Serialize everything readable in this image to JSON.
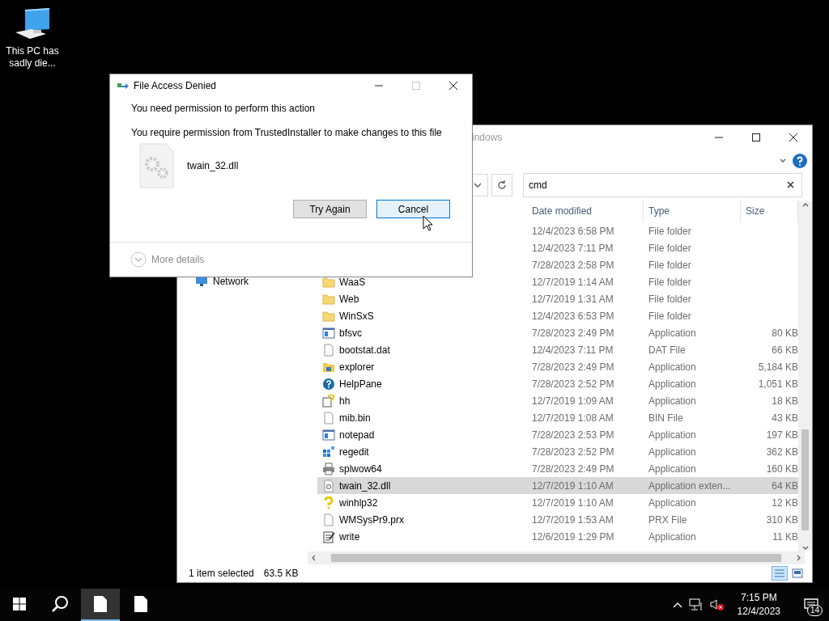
{
  "desktop": {
    "icons": [
      {
        "label": "This PC has sadly die..."
      }
    ]
  },
  "explorer": {
    "title": "indows",
    "search": {
      "value": "cmd"
    },
    "nav_items": [
      {
        "label": "Network"
      }
    ],
    "columns": [
      "Date modified",
      "Type",
      "Size"
    ],
    "rows": [
      {
        "date": "12/4/2023 6:58 PM",
        "type": "File folder",
        "size": "",
        "selected": false
      },
      {
        "date": "12/4/2023 7:11 PM",
        "type": "File folder",
        "size": "",
        "selected": false
      },
      {
        "date": "7/28/2023 2:58 PM",
        "type": "File folder",
        "size": "",
        "selected": false
      },
      {
        "kind": "folder",
        "name": "WaaS",
        "date": "12/7/2019 1:14 AM",
        "type": "File folder",
        "size": "",
        "selected": false
      },
      {
        "kind": "folder",
        "name": "Web",
        "date": "12/7/2019 1:31 AM",
        "type": "File folder",
        "size": "",
        "selected": false
      },
      {
        "kind": "folder",
        "name": "WinSxS",
        "date": "12/4/2023 6:53 PM",
        "type": "File folder",
        "size": "",
        "selected": false
      },
      {
        "kind": "window",
        "name": "bfsvc",
        "date": "7/28/2023 2:49 PM",
        "type": "Application",
        "size": "80 KB",
        "selected": false
      },
      {
        "kind": "blank",
        "name": "bootstat.dat",
        "date": "12/4/2023 7:11 PM",
        "type": "DAT File",
        "size": "66 KB",
        "selected": false
      },
      {
        "kind": "explorer",
        "name": "explorer",
        "date": "7/28/2023 2:49 PM",
        "type": "Application",
        "size": "5,184 KB",
        "selected": false
      },
      {
        "kind": "help",
        "name": "HelpPane",
        "date": "7/28/2023 2:52 PM",
        "type": "Application",
        "size": "1,051 KB",
        "selected": false
      },
      {
        "kind": "helpdoc",
        "name": "hh",
        "date": "12/7/2019 1:09 AM",
        "type": "Application",
        "size": "18 KB",
        "selected": false
      },
      {
        "kind": "blank",
        "name": "mib.bin",
        "date": "12/7/2019 1:08 AM",
        "type": "BIN File",
        "size": "43 KB",
        "selected": false
      },
      {
        "kind": "window",
        "name": "notepad",
        "date": "7/28/2023 2:53 PM",
        "type": "Application",
        "size": "197 KB",
        "selected": false
      },
      {
        "kind": "grid",
        "name": "regedit",
        "date": "7/28/2023 2:52 PM",
        "type": "Application",
        "size": "362 KB",
        "selected": false
      },
      {
        "kind": "printer",
        "name": "splwow64",
        "date": "7/28/2023 2:49 PM",
        "type": "Application",
        "size": "160 KB",
        "selected": false
      },
      {
        "kind": "gear",
        "name": "twain_32.dll",
        "date": "12/7/2019 1:10 AM",
        "type": "Application exten...",
        "size": "64 KB",
        "selected": true
      },
      {
        "kind": "question",
        "name": "winhlp32",
        "date": "12/7/2019 1:10 AM",
        "type": "Application",
        "size": "12 KB",
        "selected": false
      },
      {
        "kind": "blank",
        "name": "WMSysPr9.prx",
        "date": "12/7/2019 1:53 AM",
        "type": "PRX File",
        "size": "310 KB",
        "selected": false
      },
      {
        "kind": "pad",
        "name": "write",
        "date": "12/6/2019 1:29 PM",
        "type": "Application",
        "size": "11 KB",
        "selected": false
      }
    ],
    "status_bar": {
      "count": "1 item selected",
      "size": "63.5 KB"
    },
    "views": [
      {
        "selected": true
      },
      {
        "selected": false
      }
    ]
  },
  "dialog": {
    "title": "File Access Denied",
    "maximize_enabled": false,
    "heading": "You need permission to perform this action",
    "message": "You require permission from TrustedInstaller to make changes to this file",
    "file_name": "twain_32.dll",
    "buttons": [
      {
        "label": "Try Again",
        "focused": false
      },
      {
        "label": "Cancel",
        "focused": true
      }
    ],
    "details": "More details"
  },
  "taskbar": {
    "apps": [
      {
        "selected": true
      },
      {
        "selected": false
      }
    ],
    "time": "7:15 PM",
    "date": "12/4/2023",
    "notifications": "14"
  }
}
